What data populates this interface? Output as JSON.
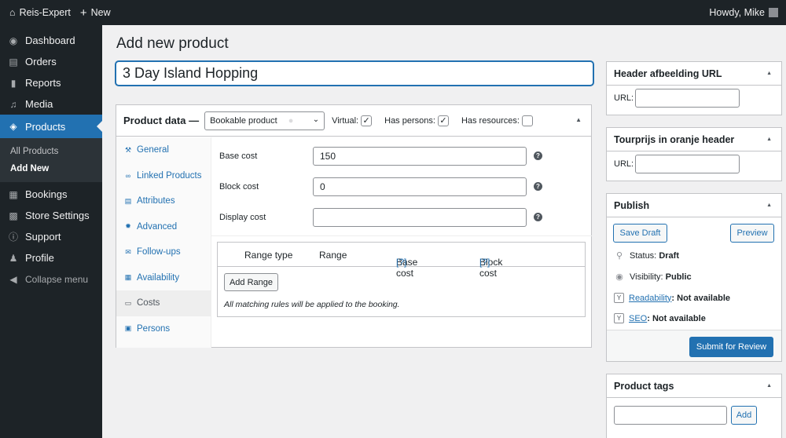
{
  "adminbar": {
    "site_name": "Reis-Expert",
    "new_label": "New",
    "greeting": "Howdy, Mike"
  },
  "sidebar": {
    "items": [
      {
        "label": "Dashboard",
        "icon": "dashboard-icon"
      },
      {
        "label": "Orders",
        "icon": "store-icon"
      },
      {
        "label": "Reports",
        "icon": "chart-bar-icon"
      },
      {
        "label": "Media",
        "icon": "media-icon"
      },
      {
        "label": "Products",
        "icon": "products-icon"
      }
    ],
    "submenu": [
      "All Products",
      "Add New"
    ],
    "items_after": [
      {
        "label": "Bookings",
        "icon": "calendar-icon"
      },
      {
        "label": "Store Settings",
        "icon": "settings-icon"
      },
      {
        "label": "Support",
        "icon": "info-icon"
      },
      {
        "label": "Profile",
        "icon": "user-icon"
      }
    ],
    "collapse_label": "Collapse menu"
  },
  "page": {
    "title": "Add new product",
    "product_title": "3 Day Island Hopping"
  },
  "product_data": {
    "label": "Product data —",
    "type": "Bookable product",
    "virtual_label": "Virtual:",
    "virtual_checked": true,
    "has_persons_label": "Has persons:",
    "has_persons_checked": true,
    "has_resources_label": "Has resources:",
    "has_resources_checked": false,
    "tabs": [
      {
        "label": "General",
        "icon": "wrench-icon"
      },
      {
        "label": "Linked Products",
        "icon": "link-icon"
      },
      {
        "label": "Attributes",
        "icon": "list-icon"
      },
      {
        "label": "Advanced",
        "icon": "gear-icon"
      },
      {
        "label": "Follow-ups",
        "icon": "email-icon"
      },
      {
        "label": "Availability",
        "icon": "calendar-icon"
      },
      {
        "label": "Costs",
        "icon": "money-icon"
      },
      {
        "label": "Persons",
        "icon": "person-icon"
      }
    ],
    "active_tab": "Costs",
    "fields": [
      {
        "label": "Base cost",
        "value": "150"
      },
      {
        "label": "Block cost",
        "value": "0"
      },
      {
        "label": "Display cost",
        "value": ""
      }
    ],
    "range_table": {
      "headers": {
        "range_type": "Range type",
        "range": "Range",
        "base_cost": "Base cost",
        "block_cost": "Block cost",
        "help": "[?]"
      },
      "add_button": "Add Range",
      "note": "All matching rules will be applied to the booking."
    }
  },
  "header_image_box": {
    "title": "Header afbeelding URL",
    "url_label": "URL:"
  },
  "tourprijs_box": {
    "title": "Tourprijs in oranje header",
    "url_label": "URL:"
  },
  "publish_box": {
    "title": "Publish",
    "save_draft": "Save Draft",
    "preview": "Preview",
    "status_label": "Status:",
    "status_value": "Draft",
    "visibility_label": "Visibility:",
    "visibility_value": "Public",
    "readability_label": "Readability",
    "readability_value": ": Not available",
    "seo_label": "SEO",
    "seo_value": ": Not available",
    "submit": "Submit for Review"
  },
  "tags_box": {
    "title": "Product tags",
    "add_button": "Add"
  }
}
